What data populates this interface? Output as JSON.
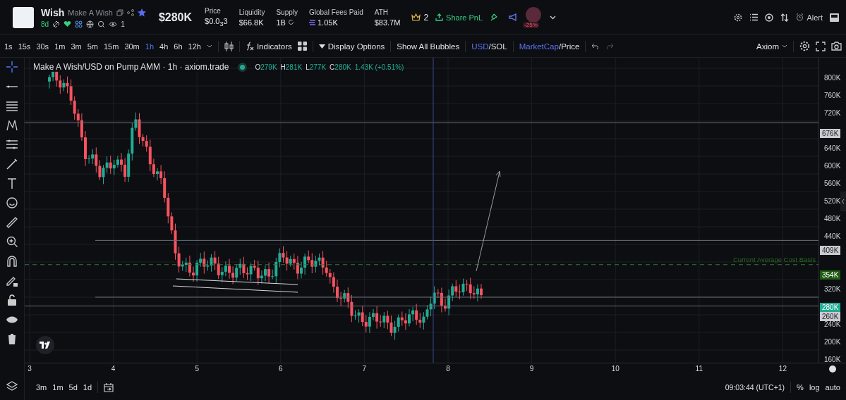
{
  "header": {
    "ticker": "Wish",
    "name": "Make A Wish",
    "age": "8d",
    "watchers": "1",
    "market_cap": "$280K",
    "stats": [
      {
        "label": "Price",
        "value": "$0.0$_{3}$3"
      },
      {
        "label": "Liquidity",
        "value": "$66.8K"
      },
      {
        "label": "Supply",
        "value": "1B"
      },
      {
        "label": "Global Fees Paid",
        "value": "1.05K"
      },
      {
        "label": "ATH",
        "value": "$83.7M"
      }
    ],
    "crown_count": "2",
    "share_button": "Share PnL",
    "pnl_badge": "-25%",
    "alert_button": "Alert"
  },
  "toolbar": {
    "intervals": [
      {
        "label": "1s",
        "selected": false
      },
      {
        "label": "15s",
        "selected": false
      },
      {
        "label": "30s",
        "selected": false
      },
      {
        "label": "1m",
        "selected": false
      },
      {
        "label": "3m",
        "selected": false
      },
      {
        "label": "5m",
        "selected": false
      },
      {
        "label": "15m",
        "selected": false
      },
      {
        "label": "30m",
        "selected": false
      },
      {
        "label": "1h",
        "selected": true
      },
      {
        "label": "4h",
        "selected": false
      },
      {
        "label": "6h",
        "selected": false
      },
      {
        "label": "12h",
        "selected": false
      }
    ],
    "indicators": "Indicators",
    "display_options": "Display Options",
    "bubbles": "Show All Bubbles",
    "currency": [
      {
        "label": "USD",
        "selected": true
      },
      {
        "label": "SOL",
        "selected": false
      }
    ],
    "metric": [
      {
        "label": "MarketCap",
        "selected": true
      },
      {
        "label": "Price",
        "selected": false
      }
    ],
    "separator": "/",
    "source": "Axiom"
  },
  "chart": {
    "legend": "Make A Wish/USD on Pump AMM · 1h · axiom.trade",
    "ohlc": [
      {
        "key": "O",
        "value": "279K"
      },
      {
        "key": "H",
        "value": "281K"
      },
      {
        "key": "L",
        "value": "277K"
      },
      {
        "key": "C",
        "value": "280K"
      }
    ],
    "change": "1.43K (+0.51%)",
    "y_ticks": [
      "800K",
      "760K",
      "720K",
      "640K",
      "600K",
      "560K",
      "520K",
      "480K",
      "440K",
      "320K",
      "240K",
      "200K",
      "160K"
    ],
    "price_labels": [
      {
        "value": "676K",
        "color": "#c9cbd2"
      },
      {
        "value": "409K",
        "color": "#c9cbd2"
      },
      {
        "value": "354K",
        "color": "#1f5a12"
      },
      {
        "value": "280K",
        "color": "#22ab94"
      },
      {
        "value": "260K",
        "color": "#c9cbd2"
      }
    ],
    "cost_basis_label": "Current Average Cost Basis",
    "x_ticks": [
      "3",
      "4",
      "5",
      "6",
      "7",
      "8",
      "9",
      "10",
      "11",
      "12"
    ]
  },
  "bottom": {
    "ranges": [
      "3m",
      "1m",
      "5d",
      "1d"
    ],
    "time": "09:03:44 (UTC+1)",
    "scale_buttons": [
      "%",
      "log",
      "auto"
    ]
  }
}
